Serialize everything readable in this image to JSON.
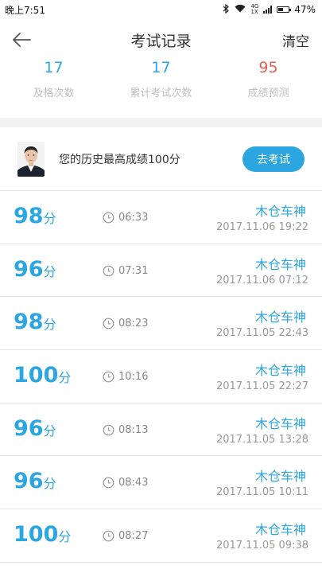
{
  "status_bar": {
    "time": "晚上7:51",
    "network_top": "4G",
    "network_bottom": "1X",
    "battery": "47%"
  },
  "header": {
    "title": "考试记录",
    "clear_label": "清空"
  },
  "stats": [
    {
      "value": "17",
      "label": "及格次数",
      "color": "#2ba6e0"
    },
    {
      "value": "17",
      "label": "累计考试次数",
      "color": "#2ba6e0"
    },
    {
      "value": "95",
      "label": "成绩预测",
      "color": "#e0604f"
    }
  ],
  "best": {
    "text": "您的历史最高成绩100分",
    "button_label": "去考试"
  },
  "records": [
    {
      "score": "98",
      "unit": "分",
      "duration": "06:33",
      "name": "木仓车神",
      "time": "2017.11.06  19:22"
    },
    {
      "score": "96",
      "unit": "分",
      "duration": "07:31",
      "name": "木仓车神",
      "time": "2017.11.06  07:12"
    },
    {
      "score": "98",
      "unit": "分",
      "duration": "08:23",
      "name": "木仓车神",
      "time": "2017.11.05  22:43"
    },
    {
      "score": "100",
      "unit": "分",
      "duration": "10:16",
      "name": "木仓车神",
      "time": "2017.11.05  22:27"
    },
    {
      "score": "96",
      "unit": "分",
      "duration": "08:13",
      "name": "木仓车神",
      "time": "2017.11.05  13:28"
    },
    {
      "score": "96",
      "unit": "分",
      "duration": "08:43",
      "name": "木仓车神",
      "time": "2017.11.05  10:11"
    },
    {
      "score": "100",
      "unit": "分",
      "duration": "08:27",
      "name": "木仓车神",
      "time": "2017.11.05  09:38"
    }
  ],
  "icons": {
    "back": "arrow-left-icon",
    "clock": "clock-icon",
    "bluetooth": "bluetooth-icon",
    "wifi": "wifi-icon",
    "signal": "signal-icon",
    "battery": "battery-icon"
  }
}
